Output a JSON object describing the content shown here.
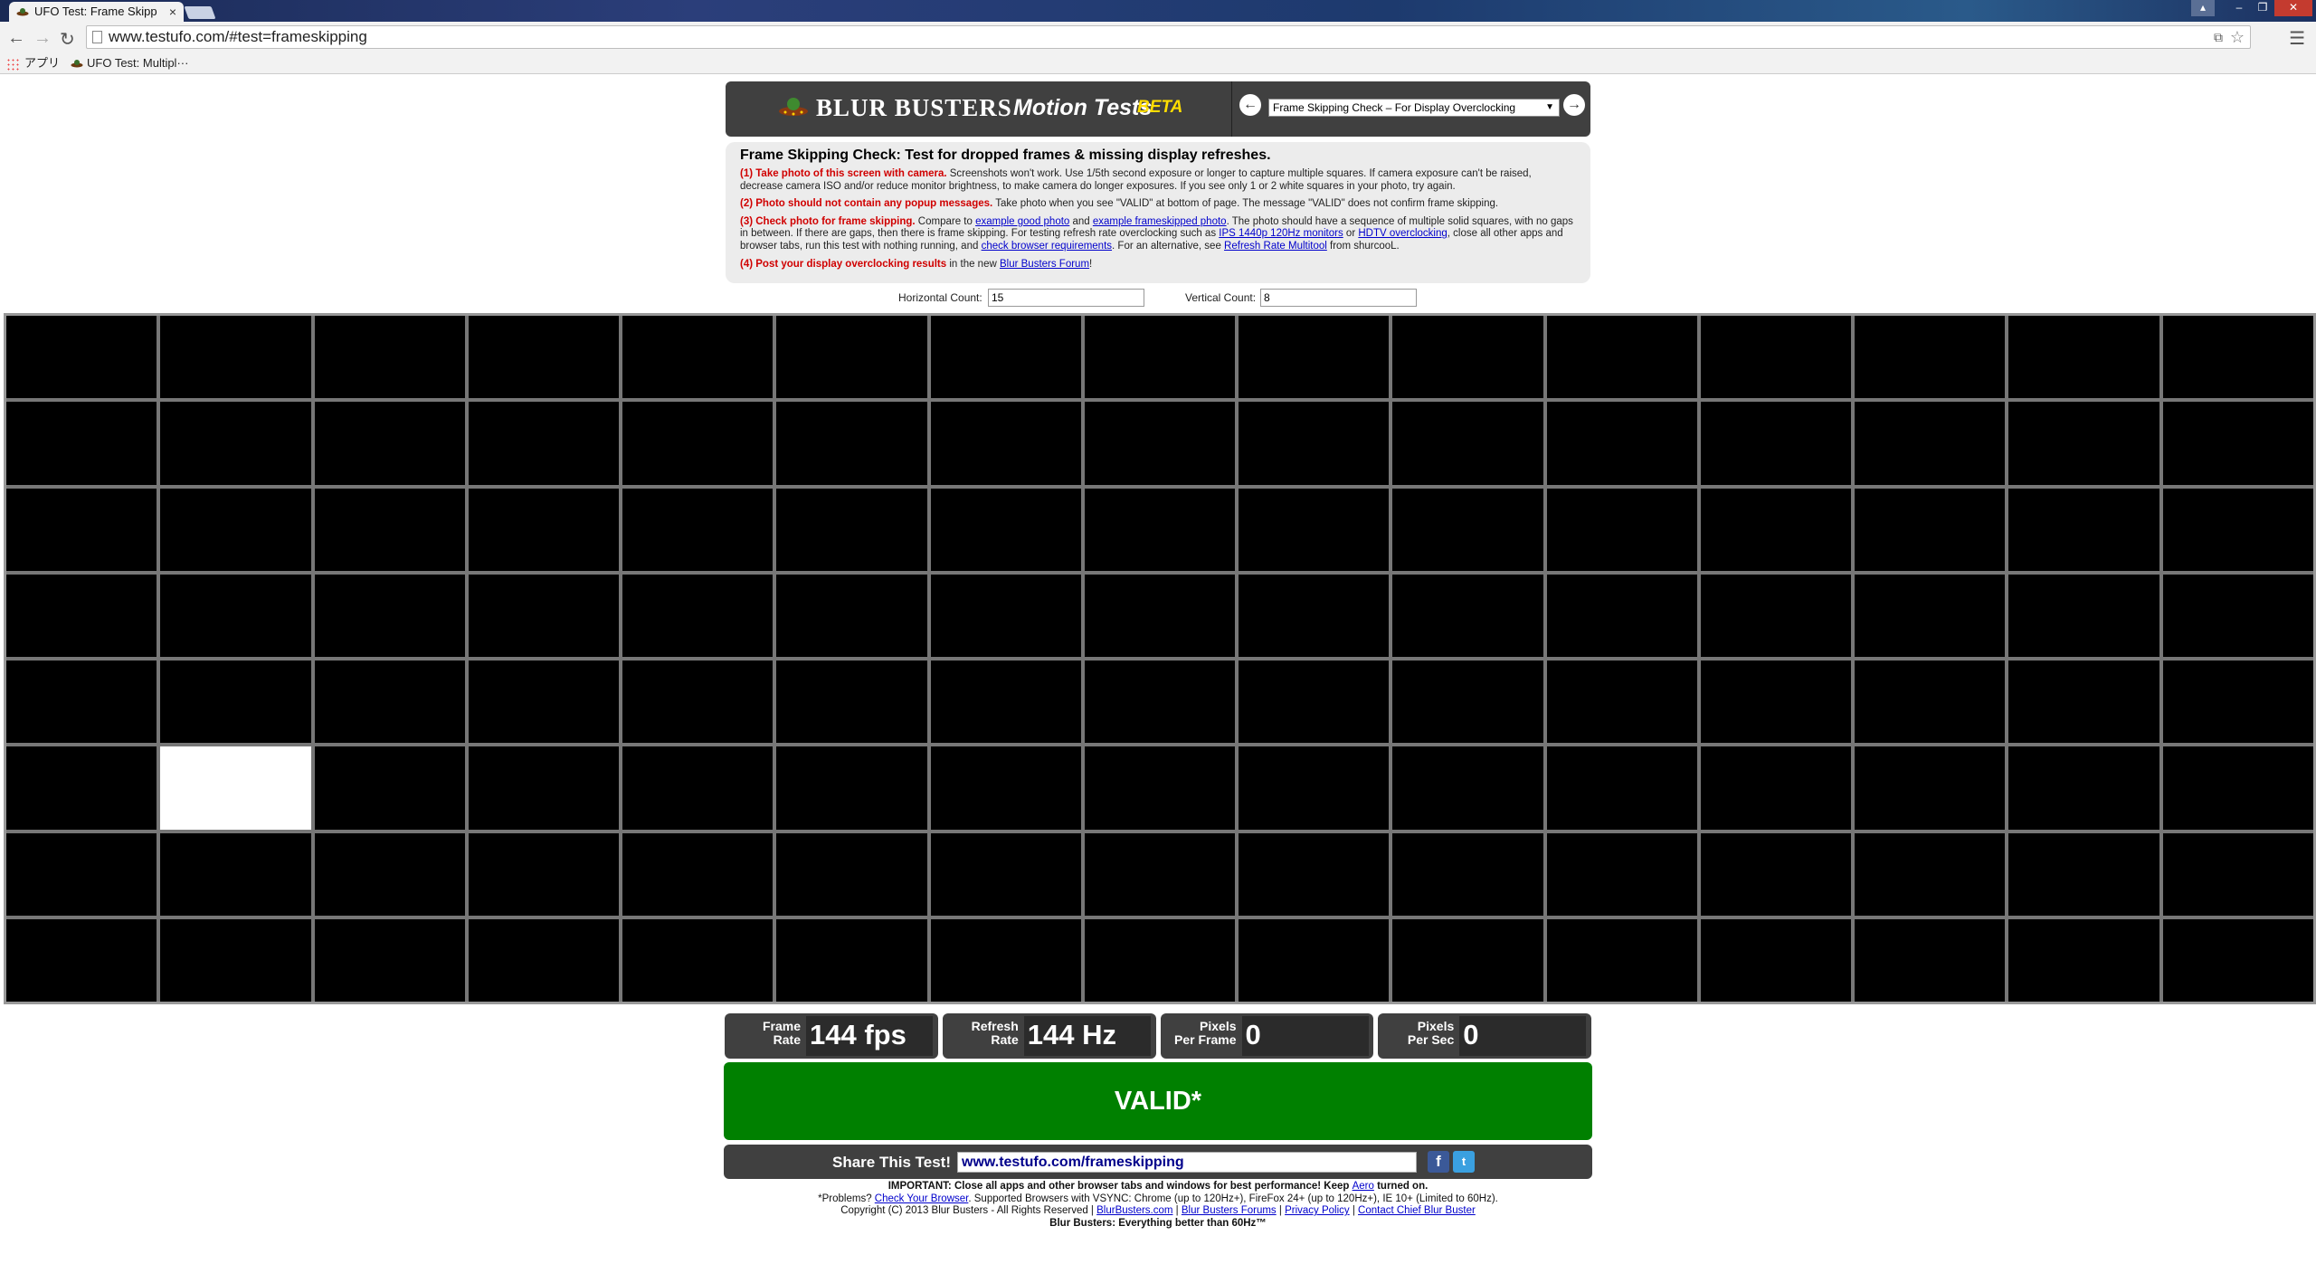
{
  "browser": {
    "tab_title": "UFO Test: Frame Skipp",
    "tab_close": "×",
    "url": "www.testufo.com/#test=frameskipping",
    "bookmarks": [
      {
        "label": "アプリ"
      },
      {
        "label": "UFO Test: Multipl···"
      }
    ]
  },
  "header": {
    "brand": "BLUR BUSTERS",
    "motion": "Motion Tests",
    "beta": "BETA",
    "prev_arrow": "←",
    "next_arrow": "→",
    "selected_test": "Frame Skipping Check – For Display Overclocking"
  },
  "instructions": {
    "title": "Frame Skipping Check: Test for dropped frames & missing display refreshes.",
    "s1_red": "(1) Take photo of this screen with camera.",
    "s1_text": " Screenshots won't work. Use 1/5th second exposure or longer to capture multiple squares. If camera exposure can't be raised, decrease camera ISO and/or reduce monitor brightness, to make camera do longer exposures. If you see only 1 or 2 white squares in your photo, try again.",
    "s2_red": "(2) Photo should not contain any popup messages.",
    "s2_text": " Take photo when you see \"VALID\" at bottom of page. The message \"VALID\" does not confirm frame skipping.",
    "s3_red": "(3) Check photo for frame skipping.",
    "s3_t1": " Compare to ",
    "s3_l1": "example good photo",
    "s3_t2": " and ",
    "s3_l2": "example frameskipped photo",
    "s3_t3": ". The photo should have a sequence of multiple solid squares, with no gaps in between. If there are gaps, then there is frame skipping. For testing refresh rate overclocking such as ",
    "s3_l3": "IPS 1440p 120Hz monitors",
    "s3_t4": " or ",
    "s3_l4": "HDTV overclocking",
    "s3_t5": ", close all other apps and browser tabs, run this test with nothing running, and ",
    "s3_l5": "check browser requirements",
    "s3_t6": ". For an alternative, see ",
    "s3_l6": "Refresh Rate Multitool",
    "s3_t7": " from shurcooL.",
    "s4_red": "(4) Post your display overclocking results",
    "s4_t1": " in the new ",
    "s4_l1": "Blur Busters Forum",
    "s4_t2": "!"
  },
  "counts": {
    "horizontal_label": "Horizontal Count:",
    "horizontal_value": "15",
    "vertical_label": "Vertical Count:",
    "vertical_value": "8"
  },
  "grid": {
    "columns": 15,
    "rows": 8,
    "lit_cell": {
      "row": 6,
      "col": 2
    }
  },
  "stats": [
    {
      "label_1": "Frame",
      "label_2": "Rate",
      "value": "144 fps"
    },
    {
      "label_1": "Refresh",
      "label_2": "Rate",
      "value": "144 Hz"
    },
    {
      "label_1": "Pixels",
      "label_2": "Per Frame",
      "value": "0"
    },
    {
      "label_1": "Pixels",
      "label_2": "Per Sec",
      "value": "0"
    }
  ],
  "status": {
    "text": "VALID*",
    "color": "#008000"
  },
  "share": {
    "label": "Share This Test!",
    "url": "www.testufo.com/frameskipping",
    "facebook": "f",
    "twitter": "t"
  },
  "footer": {
    "important_b": "IMPORTANT: Close all apps and other browser tabs and windows for best performance! Keep ",
    "aero": "Aero",
    "important_end": " turned on.",
    "problems_1": "*Problems? ",
    "check_browser": "Check Your Browser",
    "problems_2": ". Supported Browsers with VSYNC: Chrome (up to 120Hz+), FireFox 24+ (up to 120Hz+), IE 10+ (Limited to 60Hz).",
    "copyright": "Copyright (C) 2013 Blur Busters - All Rights Reserved | ",
    "link_site": "BlurBusters.com",
    "sep": " | ",
    "link_forums": "Blur Busters Forums",
    "link_privacy": "Privacy Policy",
    "link_contact": "Contact Chief Blur Buster",
    "tagline": "Blur Busters: Everything better than 60Hz™"
  },
  "colors": {
    "accent_red": "#d00000",
    "panel": "#404040",
    "valid_green": "#008000"
  }
}
